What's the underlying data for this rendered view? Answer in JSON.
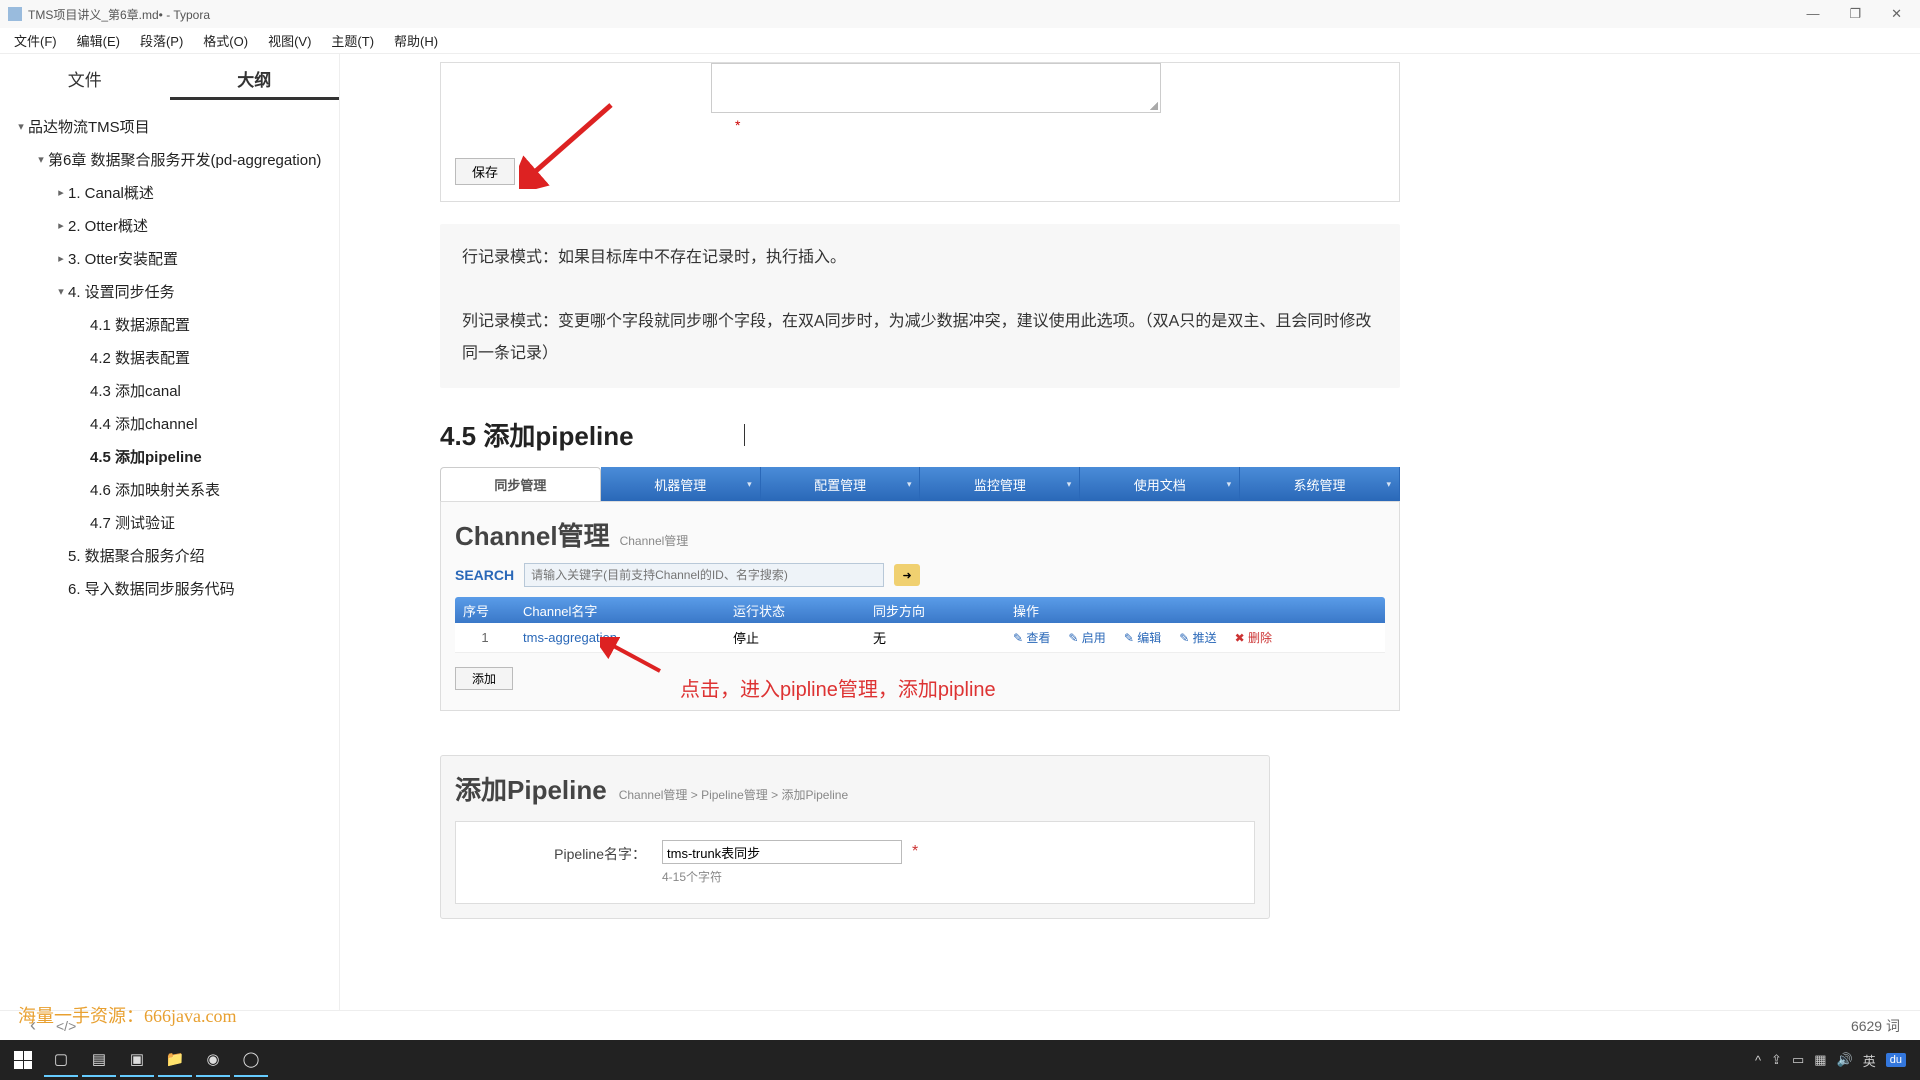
{
  "window": {
    "title": "TMS项目讲义_第6章.md• - Typora"
  },
  "winbtns": {
    "min": "—",
    "max": "❐",
    "close": "✕"
  },
  "menu": [
    "文件(F)",
    "编辑(E)",
    "段落(P)",
    "格式(O)",
    "视图(V)",
    "主题(T)",
    "帮助(H)"
  ],
  "sidebar": {
    "tabs": {
      "files": "文件",
      "outline": "大纲"
    },
    "items": [
      {
        "lvl": 0,
        "caret": "▾",
        "text": "品达物流TMS项目"
      },
      {
        "lvl": 1,
        "caret": "▾",
        "text": "第6章 数据聚合服务开发(pd-aggregation)"
      },
      {
        "lvl": 2,
        "caret": "▸",
        "text": "1. Canal概述"
      },
      {
        "lvl": 2,
        "caret": "▸",
        "text": "2. Otter概述"
      },
      {
        "lvl": 2,
        "caret": "▸",
        "text": "3. Otter安装配置"
      },
      {
        "lvl": 2,
        "caret": "▾",
        "text": "4. 设置同步任务"
      },
      {
        "lvl": 3,
        "caret": "",
        "text": "4.1 数据源配置"
      },
      {
        "lvl": 3,
        "caret": "",
        "text": "4.2 数据表配置"
      },
      {
        "lvl": 3,
        "caret": "",
        "text": "4.3 添加canal"
      },
      {
        "lvl": 3,
        "caret": "",
        "text": "4.4 添加channel"
      },
      {
        "lvl": 3,
        "caret": "",
        "text": "4.5 添加pipeline",
        "active": true
      },
      {
        "lvl": 3,
        "caret": "",
        "text": "4.6 添加映射关系表"
      },
      {
        "lvl": 3,
        "caret": "",
        "text": "4.7 测试验证"
      },
      {
        "lvl": 2,
        "caret": "",
        "text": "5. 数据聚合服务介绍"
      },
      {
        "lvl": 2,
        "caret": "",
        "text": "6. 导入数据同步服务代码"
      }
    ]
  },
  "content": {
    "save_btn": "保存",
    "note_line1": "行记录模式：如果目标库中不存在记录时，执行插入。",
    "note_line2": "列记录模式：变更哪个字段就同步哪个字段，在双A同步时，为减少数据冲突，建议使用此选项。（双A只的是双主、且会同时修改同一条记录）",
    "h2": "4.5 添加pipeline",
    "topbar": [
      "同步管理",
      "机器管理",
      "配置管理",
      "监控管理",
      "使用文档",
      "系统管理"
    ],
    "ch_title": "Channel管理",
    "ch_bc": "Channel管理",
    "search": {
      "label": "SEARCH",
      "placeholder": "请输入关键字(目前支持Channel的ID、名字搜索)",
      "go": "➜"
    },
    "th": [
      "序号",
      "Channel名字",
      "运行状态",
      "同步方向",
      "操作"
    ],
    "row": {
      "no": "1",
      "name": "tms-aggregation",
      "status": "停止",
      "dir": "无"
    },
    "ops": {
      "view": "查看",
      "enable": "启用",
      "edit": "编辑",
      "push": "推送",
      "del": "删除"
    },
    "add_btn": "添加",
    "hint": "点击，进入pipline管理，添加pipline",
    "img3": {
      "title": "添加Pipeline",
      "bc": "Channel管理  >  Pipeline管理  >  添加Pipeline",
      "label": "Pipeline名字：",
      "value": "tms-trunk表同步",
      "hint": "4-15个字符"
    }
  },
  "status": {
    "back": "‹",
    "src": "</>",
    "words": "6629 词"
  },
  "watermark": "海量一手资源：666java.com",
  "tray": {
    "ime": "英"
  }
}
